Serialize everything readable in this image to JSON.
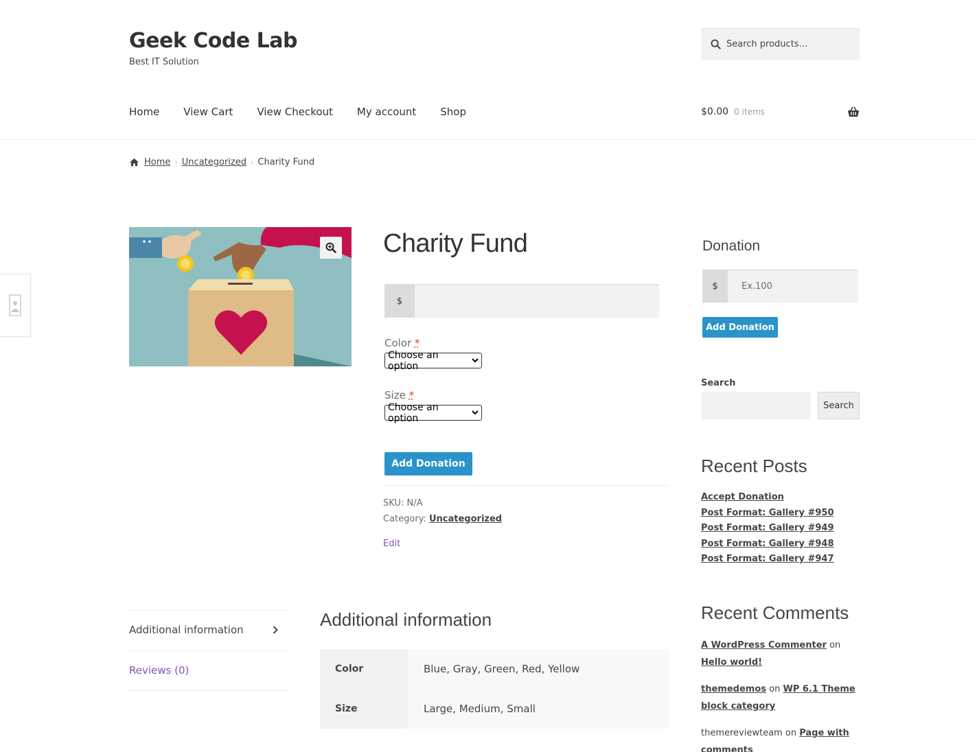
{
  "header": {
    "site_title": "Geek Code Lab",
    "tagline": "Best IT Solution",
    "search_placeholder": "Search products…"
  },
  "nav": {
    "items": [
      {
        "label": "Home"
      },
      {
        "label": "View Cart"
      },
      {
        "label": "View Checkout"
      },
      {
        "label": "My account"
      },
      {
        "label": "Shop"
      }
    ]
  },
  "cart": {
    "amount": "$0.00",
    "count": "0 items"
  },
  "breadcrumb": {
    "home": "Home",
    "category": "Uncategorized",
    "current": "Charity Fund"
  },
  "product": {
    "title": "Charity Fund",
    "currency_symbol": "$",
    "color_label": "Color",
    "size_label": "Size",
    "required_marker": "*",
    "select_placeholder": "Choose an option",
    "add_button": "Add Donation",
    "sku_label": "SKU:",
    "sku_value": "N/A",
    "category_label": "Category:",
    "category_value": "Uncategorized",
    "edit_link": "Edit"
  },
  "sidebar": {
    "donation": {
      "title": "Donation",
      "currency_symbol": "$",
      "placeholder": "Ex.100",
      "button": "Add Donation"
    },
    "search": {
      "label": "Search",
      "button": "Search"
    },
    "recent_posts": {
      "title": "Recent Posts",
      "items": [
        "Accept Donation",
        "Post Format: Gallery #950",
        "Post Format: Gallery #949",
        "Post Format: Gallery #948",
        "Post Format: Gallery #947"
      ]
    },
    "recent_comments": {
      "title": "Recent Comments",
      "items": [
        {
          "author": "A WordPress Commenter",
          "on": "on",
          "post": "Hello world!"
        },
        {
          "author": "themedemos",
          "on": "on",
          "post": "WP 6.1 Theme block category"
        },
        {
          "author": "themereviewteam",
          "on": "on",
          "post": "Page with comments"
        }
      ]
    }
  },
  "tabs": {
    "additional": "Additional information",
    "reviews": "Reviews (0)"
  },
  "additional_info": {
    "title": "Additional information",
    "rows": [
      {
        "name": "Color",
        "value": "Blue, Gray, Green, Red, Yellow"
      },
      {
        "name": "Size",
        "value": "Large, Medium, Small"
      }
    ]
  },
  "colors": {
    "button_blue": "#2a93c9",
    "link_purple": "#7f54b3",
    "required_red": "#e2401c",
    "text": "#43454b"
  }
}
